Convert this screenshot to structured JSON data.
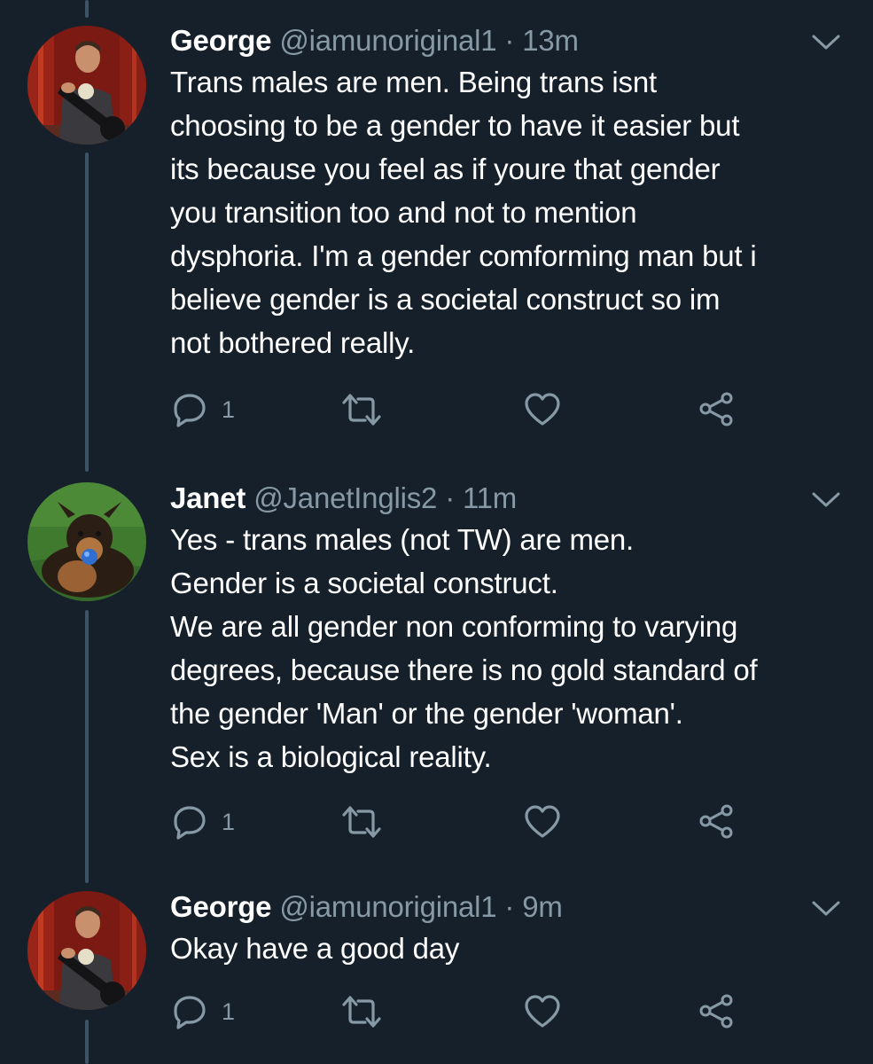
{
  "colors": {
    "background": "#15202b",
    "secondary_text": "#8899a6",
    "thread_line": "#3d5466",
    "primary_text": "#ffffff"
  },
  "icons": {
    "reply": "reply-icon",
    "retweet": "retweet-icon",
    "like": "heart-icon",
    "share": "share-icon",
    "menu": "chevron-down-icon"
  },
  "tweets": [
    {
      "name": "George",
      "handle": "@iamunoriginal1",
      "separator": "·",
      "time": "13m",
      "lines": [
        "Trans males are men. Being trans isnt",
        "choosing to be a gender to have it easier but",
        "its because you feel as if youre that gender",
        "you transition too and not to mention",
        "dysphoria. I'm a gender comforming man but i",
        "believe gender is a societal construct so im",
        "not bothered really."
      ],
      "reply_count": "1"
    },
    {
      "name": "Janet",
      "handle": "@JanetInglis2",
      "separator": "·",
      "time": "11m",
      "lines": [
        "Yes - trans males (not TW) are men.",
        "Gender is a societal construct.",
        "We are all gender non conforming to varying",
        "degrees, because there is no gold standard of",
        "the gender 'Man' or the gender 'woman'.",
        "Sex is a biological reality."
      ],
      "reply_count": "1"
    },
    {
      "name": "George",
      "handle": "@iamunoriginal1",
      "separator": "·",
      "time": "9m",
      "lines": [
        "Okay have a good day"
      ],
      "reply_count": "1"
    }
  ]
}
